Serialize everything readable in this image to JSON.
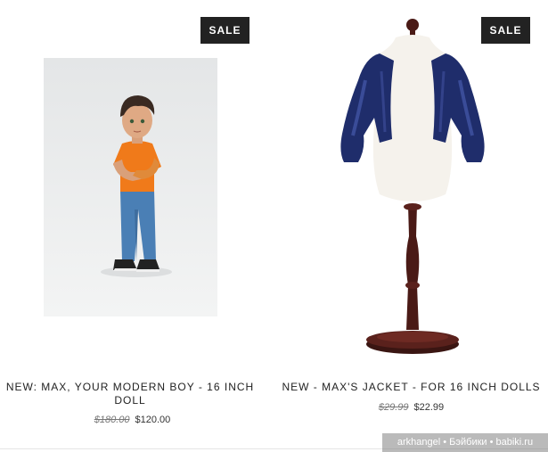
{
  "colors": {
    "badge_bg": "#222222",
    "badge_text": "#ffffff",
    "title_text": "#222222",
    "old_price_text": "#777777"
  },
  "products": [
    {
      "badge": "SALE",
      "title": "NEW: MAX, YOUR MODERN BOY - 16 INCH DOLL",
      "old_price": "$180.00",
      "price": "$120.00",
      "image": "boy-doll-photo"
    },
    {
      "badge": "SALE",
      "title": "NEW - MAX'S JACKET - FOR 16 INCH DOLLS",
      "old_price": "$29.99",
      "price": "$22.99",
      "image": "jacket-on-dress-form-photo"
    }
  ],
  "watermark": "arkhangel • Бэйбики • babiki.ru"
}
